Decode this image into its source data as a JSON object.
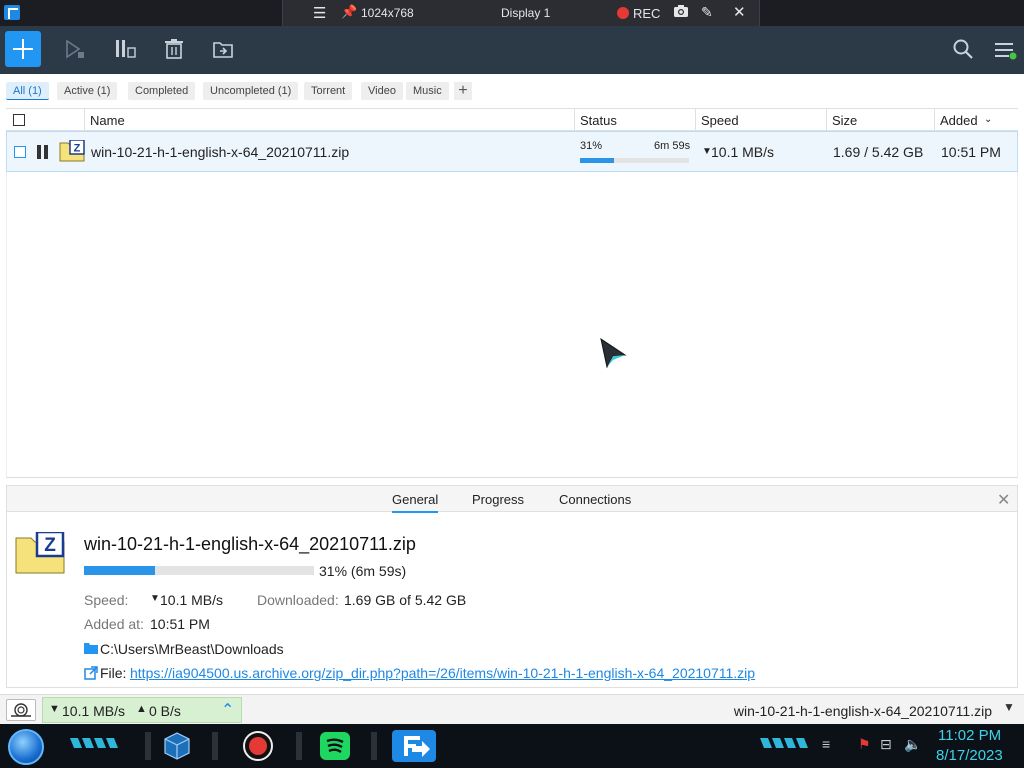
{
  "remote_bar": {
    "menu_icon": "hamburger-icon",
    "resolution": "1024x768",
    "display": "Display 1",
    "rec_label": "REC"
  },
  "filters": [
    "All (1)",
    "Active (1)",
    "Completed",
    "Uncompleted (1)",
    "Torrent",
    "Video",
    "Music"
  ],
  "table": {
    "columns": {
      "name": "Name",
      "status": "Status",
      "speed": "Speed",
      "size": "Size",
      "added": "Added"
    },
    "rows": [
      {
        "name": "win-10-21-h-1-english-x-64_20210711.zip",
        "progress_percent": "31%",
        "progress_value": 31,
        "time_left": "6m 59s",
        "speed": "10.1 MB/s",
        "size": "1.69 / 5.42 GB",
        "added": "10:51 PM"
      }
    ]
  },
  "details": {
    "tabs": [
      "General",
      "Progress",
      "Connections"
    ],
    "title": "win-10-21-h-1-english-x-64_20210711.zip",
    "progress_text": "31% (6m 59s)",
    "speed_label": "Speed:",
    "speed_value": "10.1 MB/s",
    "downloaded_label": "Downloaded:",
    "downloaded_value": "1.69 GB of 5.42 GB",
    "added_label": "Added at:",
    "added_value": "10:51 PM",
    "folder": "C:\\Users\\MrBeast\\Downloads",
    "file_label": "File:",
    "file_url": "https://ia904500.us.archive.org/zip_dir.php?path=/26/items/win-10-21-h-1-english-x-64_20210711.zip"
  },
  "statusbar": {
    "down_speed": "10.1 MB/s",
    "up_speed": "0 B/s",
    "current_file": "win-10-21-h-1-english-x-64_20210711.zip"
  },
  "taskbar": {
    "time": "11:02 PM",
    "date": "8/17/2023"
  },
  "colors": {
    "accent": "#2196f3",
    "toolbar_bg": "#2c3a47",
    "progress": "#2a95e8",
    "speed_box": "#d7f0d2",
    "clock": "#3fd2e8"
  }
}
